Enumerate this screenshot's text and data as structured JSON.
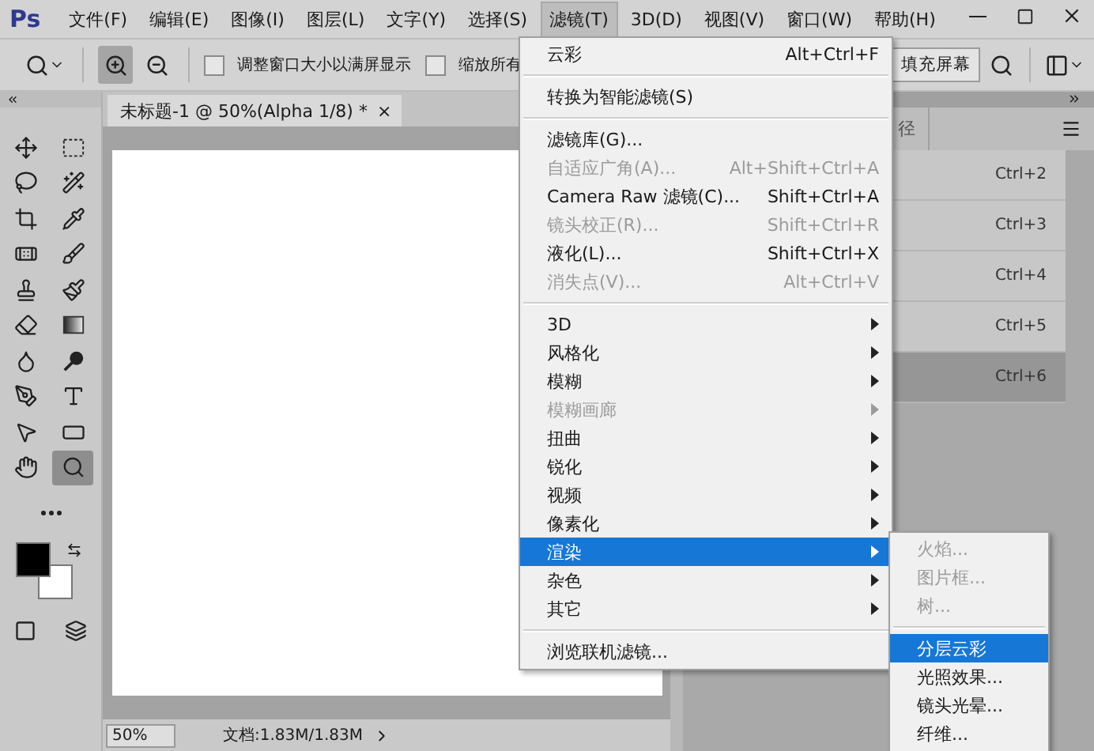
{
  "app_logo": "Ps",
  "menubar": [
    {
      "label": "文件(F)",
      "selected": false
    },
    {
      "label": "编辑(E)",
      "selected": false
    },
    {
      "label": "图像(I)",
      "selected": false
    },
    {
      "label": "图层(L)",
      "selected": false
    },
    {
      "label": "文字(Y)",
      "selected": false
    },
    {
      "label": "选择(S)",
      "selected": false
    },
    {
      "label": "滤镜(T)",
      "selected": true
    },
    {
      "label": "3D(D)",
      "selected": false
    },
    {
      "label": "视图(V)",
      "selected": false
    },
    {
      "label": "窗口(W)",
      "selected": false
    },
    {
      "label": "帮助(H)",
      "selected": false
    }
  ],
  "options_bar": {
    "zoom_buttons": [
      {
        "kind": "zoom-in",
        "selected": true
      },
      {
        "kind": "zoom-out",
        "selected": false
      }
    ],
    "checkboxes": [
      {
        "label": "调整窗口大小以满屏显示",
        "checked": false
      },
      {
        "label": "缩放所有",
        "checked": false
      }
    ],
    "fill_screen_button": "填充屏幕"
  },
  "tools": [
    {
      "kind": "move",
      "selected": false
    },
    {
      "kind": "marquee",
      "selected": false
    },
    {
      "kind": "lasso",
      "selected": false
    },
    {
      "kind": "wand",
      "selected": false
    },
    {
      "kind": "crop",
      "selected": false
    },
    {
      "kind": "eyedropper",
      "selected": false
    },
    {
      "kind": "healing",
      "selected": false
    },
    {
      "kind": "brush",
      "selected": false
    },
    {
      "kind": "stamp",
      "selected": false
    },
    {
      "kind": "history-brush",
      "selected": false
    },
    {
      "kind": "eraser",
      "selected": false
    },
    {
      "kind": "gradient",
      "selected": false
    },
    {
      "kind": "blur",
      "selected": false
    },
    {
      "kind": "dodge",
      "selected": false
    },
    {
      "kind": "pen",
      "selected": false
    },
    {
      "kind": "type",
      "selected": false
    },
    {
      "kind": "path-select",
      "selected": false
    },
    {
      "kind": "rectangle",
      "selected": false
    },
    {
      "kind": "hand",
      "selected": false
    },
    {
      "kind": "zoom",
      "selected": true
    }
  ],
  "document": {
    "tab_title": "未标题-1 @ 50%(Alpha 1/8) *",
    "close": "×",
    "zoom": "50%",
    "doc_info": "文档:1.83M/1.83M"
  },
  "panel": {
    "tab": "径",
    "rows": [
      {
        "shortcut": "Ctrl+2",
        "selected": false
      },
      {
        "shortcut": "Ctrl+3",
        "selected": false
      },
      {
        "shortcut": "Ctrl+4",
        "selected": false
      },
      {
        "shortcut": "Ctrl+5",
        "selected": false
      },
      {
        "shortcut": "Ctrl+6",
        "selected": true
      }
    ]
  },
  "filter_menu": [
    [
      {
        "label": "云彩",
        "shortcut": "Alt+Ctrl+F",
        "disabled": false,
        "submenu": false,
        "selected": false
      }
    ],
    [
      {
        "label": "转换为智能滤镜(S)",
        "disabled": false,
        "submenu": false,
        "selected": false
      }
    ],
    [
      {
        "label": "滤镜库(G)...",
        "disabled": false,
        "submenu": false,
        "selected": false
      },
      {
        "label": "自适应广角(A)...",
        "shortcut": "Alt+Shift+Ctrl+A",
        "disabled": true,
        "submenu": false,
        "selected": false
      },
      {
        "label": "Camera Raw 滤镜(C)...",
        "shortcut": "Shift+Ctrl+A",
        "disabled": false,
        "submenu": false,
        "selected": false
      },
      {
        "label": "镜头校正(R)...",
        "shortcut": "Shift+Ctrl+R",
        "disabled": true,
        "submenu": false,
        "selected": false
      },
      {
        "label": "液化(L)...",
        "shortcut": "Shift+Ctrl+X",
        "disabled": false,
        "submenu": false,
        "selected": false
      },
      {
        "label": "消失点(V)...",
        "shortcut": "Alt+Ctrl+V",
        "disabled": true,
        "submenu": false,
        "selected": false
      }
    ],
    [
      {
        "label": "3D",
        "disabled": false,
        "submenu": true,
        "selected": false
      },
      {
        "label": "风格化",
        "disabled": false,
        "submenu": true,
        "selected": false
      },
      {
        "label": "模糊",
        "disabled": false,
        "submenu": true,
        "selected": false
      },
      {
        "label": "模糊画廊",
        "disabled": true,
        "submenu": true,
        "selected": false
      },
      {
        "label": "扭曲",
        "disabled": false,
        "submenu": true,
        "selected": false
      },
      {
        "label": "锐化",
        "disabled": false,
        "submenu": true,
        "selected": false
      },
      {
        "label": "视频",
        "disabled": false,
        "submenu": true,
        "selected": false
      },
      {
        "label": "像素化",
        "disabled": false,
        "submenu": true,
        "selected": false
      },
      {
        "label": "渲染",
        "disabled": false,
        "submenu": true,
        "selected": true
      },
      {
        "label": "杂色",
        "disabled": false,
        "submenu": true,
        "selected": false
      },
      {
        "label": "其它",
        "disabled": false,
        "submenu": true,
        "selected": false
      }
    ],
    [
      {
        "label": "浏览联机滤镜...",
        "disabled": false,
        "submenu": false,
        "selected": false
      }
    ]
  ],
  "render_submenu": [
    [
      {
        "label": "火焰...",
        "disabled": true,
        "selected": false
      },
      {
        "label": "图片框...",
        "disabled": true,
        "selected": false
      },
      {
        "label": "树...",
        "disabled": true,
        "selected": false
      }
    ],
    [
      {
        "label": "分层云彩",
        "disabled": false,
        "selected": true
      },
      {
        "label": "光照效果...",
        "disabled": false,
        "selected": false
      },
      {
        "label": "镜头光晕...",
        "disabled": false,
        "selected": false
      },
      {
        "label": "纤维...",
        "disabled": false,
        "selected": false
      }
    ]
  ]
}
